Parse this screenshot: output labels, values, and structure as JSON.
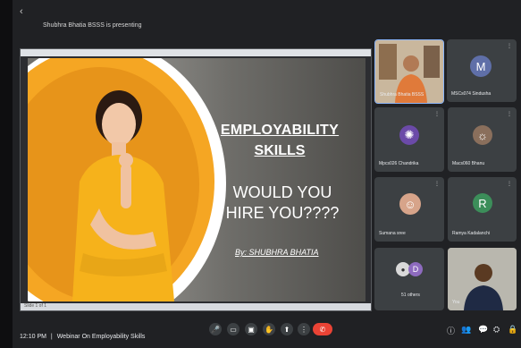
{
  "topbar": {
    "presenting_text": "Shubhra Bhatia BSSS is presenting",
    "back_icon": "chevron-left-icon"
  },
  "slide": {
    "title_line1": "EMPLOYABILITY",
    "title_line2": "SKILLS",
    "question_line1": "WOULD YOU",
    "question_line2": "HIRE YOU????",
    "byline": "By: SHUBHRA BHATIA",
    "footer_text": "Slide 1 of 1"
  },
  "participants": [
    {
      "name": "Shubhra Bhatia BSSS",
      "initial": "",
      "avatar_color": "#b0835a"
    },
    {
      "name": "MSCs074 Sindusha",
      "initial": "M",
      "avatar_color": "#5f6fa8"
    },
    {
      "name": "Mpcs026 Chandrika",
      "initial": "",
      "avatar_color": "#6b4aa8"
    },
    {
      "name": "Macs060 Bhanu",
      "initial": "",
      "avatar_color": "#8a6f5c"
    },
    {
      "name": "Sumana sree",
      "initial": "",
      "avatar_color": "#d7a48a"
    },
    {
      "name": "Ramya Kadalanchi",
      "initial": "R",
      "avatar_color": "#3c8e5a"
    },
    {
      "name": "51 others",
      "initial": "D",
      "avatar_color": "#8e6bbf"
    },
    {
      "name": "You",
      "initial": "",
      "avatar_color": "#7a5c3a"
    }
  ],
  "bottombar": {
    "time": "12:10 PM",
    "separator": "|",
    "meeting_title": "Webinar On Employability Skills",
    "controls": [
      "mic-icon",
      "captions-icon",
      "present-icon",
      "hand-icon",
      "share-icon",
      "more-icon"
    ],
    "end_call_icon": "end-call-icon",
    "right_controls": [
      "info-icon",
      "people-icon",
      "chat-icon",
      "activities-icon",
      "lock-icon"
    ]
  }
}
